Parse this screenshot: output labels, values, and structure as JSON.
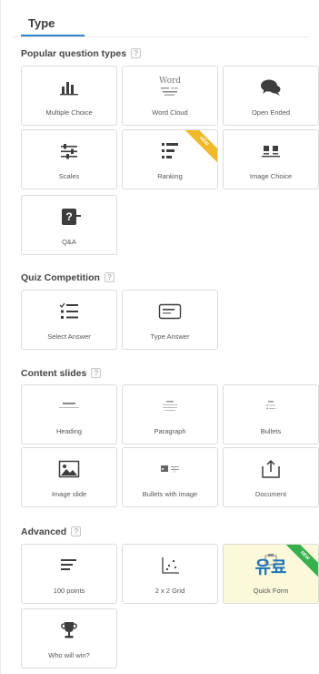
{
  "tab": {
    "label": "Type"
  },
  "sections": {
    "popular": {
      "title": "Popular question types",
      "help": "?"
    },
    "quiz": {
      "title": "Quiz Competition",
      "help": "?"
    },
    "content": {
      "title": "Content slides",
      "help": "?"
    },
    "advanced": {
      "title": "Advanced",
      "help": "?"
    }
  },
  "tiles": {
    "multiple_choice": {
      "label": "Multiple Choice",
      "icon": "bar-chart-icon"
    },
    "word_cloud": {
      "label": "Word Cloud",
      "icon": "word-cloud-icon",
      "icon_text": "Word"
    },
    "open_ended": {
      "label": "Open Ended",
      "icon": "speech-bubbles-icon"
    },
    "scales": {
      "label": "Scales",
      "icon": "sliders-icon"
    },
    "ranking": {
      "label": "Ranking",
      "icon": "ranking-icon",
      "ribbon": "NEW"
    },
    "image_choice": {
      "label": "Image Choice",
      "icon": "image-choice-icon"
    },
    "qa": {
      "label": "Q&A",
      "icon": "question-mark-icon",
      "icon_text": "?"
    },
    "select_answer": {
      "label": "Select Answer",
      "icon": "checklist-icon"
    },
    "type_answer": {
      "label": "Type Answer",
      "icon": "text-input-icon"
    },
    "heading": {
      "label": "Heading",
      "icon": "heading-icon"
    },
    "paragraph": {
      "label": "Paragraph",
      "icon": "paragraph-icon"
    },
    "bullets": {
      "label": "Bullets",
      "icon": "bullets-icon"
    },
    "image_slide": {
      "label": "Image slide",
      "icon": "image-icon"
    },
    "bullets_with_image": {
      "label": "Bullets with image",
      "icon": "bullets-image-icon"
    },
    "document": {
      "label": "Document",
      "icon": "document-upload-icon"
    },
    "points_100": {
      "label": "100 points",
      "icon": "lines-icon"
    },
    "grid_2x2": {
      "label": "2 x 2 Grid",
      "icon": "grid-plot-icon"
    },
    "quick_form": {
      "label": "Quick Form",
      "icon": "form-icon",
      "overlay_text": "유료",
      "ribbon": "NEW"
    },
    "who_will_win": {
      "label": "Who will win?",
      "icon": "trophy-icon"
    }
  },
  "colors": {
    "tab_underline": "#2f83c6",
    "ribbon_new": "#f0b92a",
    "ribbon_premium": "#38b04d",
    "premium_tile_bg": "#fbf9d9",
    "overlay_text": "#1f73b7",
    "icon_dark": "#3d3d3d"
  }
}
